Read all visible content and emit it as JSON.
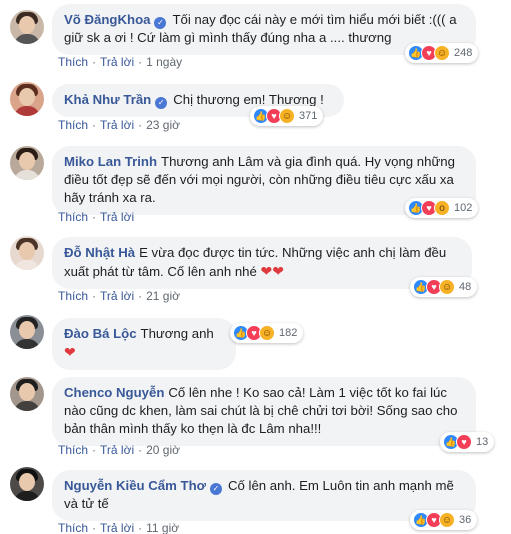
{
  "actions": {
    "like": "Thích",
    "reply": "Trả lời"
  },
  "comments": [
    {
      "name": "Võ ĐăngKhoa",
      "verified": true,
      "text": "Tối nay đọc cái này e mới tìm hiểu mới biết :((( a giữ sk a ơi ! Cứ làm gì mình thấy đúng nha a .... thương",
      "time": "1 ngày",
      "reactions": [
        "like-icon",
        "love-icon",
        "haha-icon"
      ],
      "count": "248"
    },
    {
      "name": "Khả Như Trần",
      "verified": true,
      "text": "Chị thương em! Thương !",
      "time": "23 giờ",
      "reactions": [
        "like-icon",
        "love-icon",
        "haha-icon"
      ],
      "count": "371"
    },
    {
      "name": "Miko Lan Trinh",
      "verified": false,
      "text": "Thương anh Lâm và gia đình quá. Hy vọng những điều tốt đẹp sẽ đến với mọi người, còn những điều tiêu cực xấu xa hãy tránh xa ra.",
      "time": "",
      "reactions": [
        "like-icon",
        "love-icon",
        "wow-icon"
      ],
      "count": "102"
    },
    {
      "name": "Đỗ Nhật Hà",
      "verified": false,
      "text": "E vừa đọc được tin tức. Những việc anh chị làm đều xuất phát từ tâm. Cố lên anh nhé",
      "time": "21 giờ",
      "reactions": [
        "like-icon",
        "love-icon",
        "haha-icon"
      ],
      "count": "48"
    },
    {
      "name": "Đào Bá Lộc",
      "verified": false,
      "text": "Thương anh",
      "time": "",
      "reactions": [
        "like-icon",
        "love-icon",
        "haha-icon"
      ],
      "count": "182"
    },
    {
      "name": "Chenco Nguyễn",
      "verified": false,
      "text": "Cố lên nhe ! Ko sao cả! Làm 1 việc tốt ko fai lúc nào cũng dc khen, làm sai chút là bị chê chửi tơi bời! Sống sao cho bản thân mình thấy ko thẹn là đc Lâm nha!!!",
      "time": "20 giờ",
      "reactions": [
        "like-icon",
        "love-icon"
      ],
      "count": "13"
    },
    {
      "name": "Nguyễn Kiều Cẩm Thơ",
      "verified": true,
      "text": "Cố lên anh. Em Luôn tin anh mạnh mẽ và tử tế",
      "time": "11 giờ",
      "reactions": [
        "like-icon",
        "love-icon",
        "haha-icon"
      ],
      "count": "36"
    }
  ],
  "colors": {
    "name": "#385898",
    "bubble": "#f2f3f5",
    "like": "#2e89ff",
    "love": "#f33e58",
    "haha": "#f7b125"
  }
}
